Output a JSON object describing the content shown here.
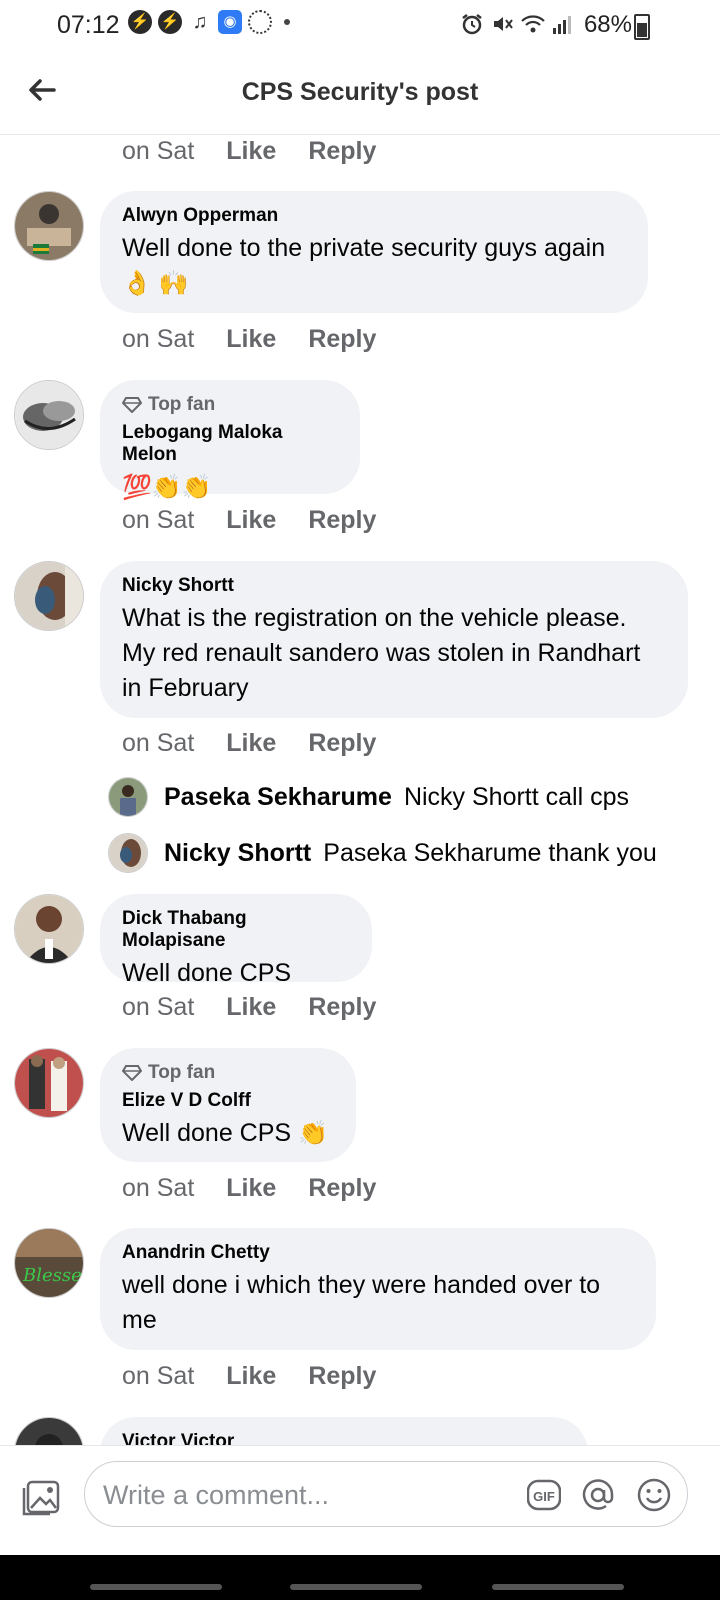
{
  "status_bar": {
    "time": "07:12",
    "battery": "68%",
    "icons": [
      "bolt-icon",
      "bolt-icon",
      "music-note-icon",
      "calendar-app-icon",
      "loading-ring-icon",
      "alarm-icon",
      "mute-icon",
      "wifi-icon",
      "signal-icon",
      "battery-icon"
    ]
  },
  "header": {
    "title": "CPS Security's post",
    "back_icon": "back-arrow-icon"
  },
  "labels": {
    "time": "on Sat",
    "like": "Like",
    "reply": "Reply",
    "top_fan": "Top fan"
  },
  "comments": [
    {
      "author": "Alwyn Opperman",
      "text": "Well done to the private security guys again",
      "emoji": "👌 🙌",
      "top_fan": false
    },
    {
      "author": "Lebogang Maloka Melon",
      "text": "",
      "emoji": "💯👏👏",
      "top_fan": true
    },
    {
      "author": "Nicky Shortt",
      "text": "What is the registration on the vehicle please. My red renault sandero was stolen in Randhart in February",
      "emoji": "",
      "top_fan": false
    },
    {
      "author": "Dick Thabang Molapisane",
      "text": "Well done CPS",
      "emoji": "",
      "top_fan": false
    },
    {
      "author": "Elize V D Colff",
      "text": "Well done CPS",
      "emoji": "👏",
      "top_fan": true
    },
    {
      "author": "Anandrin Chetty",
      "text": "well  done  i which they were handed over to me",
      "emoji": "",
      "top_fan": false
    },
    {
      "author": "Victor Victor",
      "text": "",
      "emoji": "",
      "top_fan": false
    }
  ],
  "replies": [
    {
      "author": "Paseka Sekharume",
      "text": "Nicky Shortt call cps"
    },
    {
      "author": "Nicky Shortt",
      "text": "Paseka Sekharume thank you"
    }
  ],
  "composer": {
    "placeholder": "Write a comment...",
    "icons": [
      "photo-gallery-icon",
      "gif-icon",
      "mention-icon",
      "emoji-icon"
    ],
    "accent": "#65676b"
  },
  "colors": {
    "bubble": "#f0f2f5",
    "secondary_text": "#65676b"
  }
}
